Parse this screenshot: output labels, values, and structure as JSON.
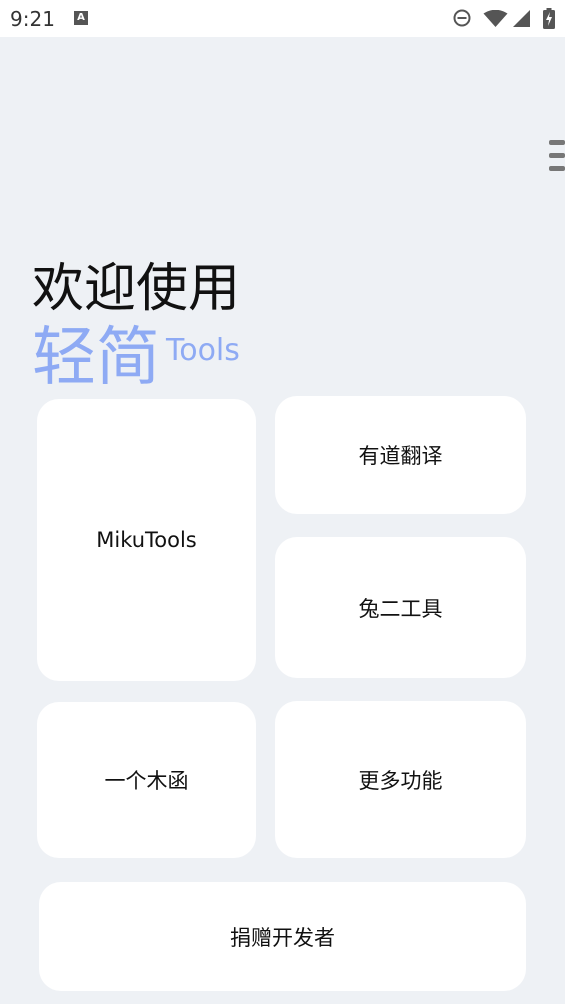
{
  "status_bar": {
    "time": "9:21",
    "notification_icon_letter": "A",
    "icons": [
      "do-not-disturb-icon",
      "wifi-icon",
      "cellular-signal-icon",
      "battery-charging-icon"
    ]
  },
  "header": {
    "menu_icon": "menu-icon",
    "welcome": "欢迎使用",
    "brand_cn": "轻简",
    "brand_en": "Tools"
  },
  "cards": {
    "mikutools": "MikuTools",
    "youdao": "有道翻译",
    "tuer": "兔二工具",
    "muhan": "一个木函",
    "more": "更多功能",
    "donate": "捐赠开发者"
  },
  "colors": {
    "background": "#eef1f5",
    "brand": "#8eaaf4",
    "card": "#ffffff"
  }
}
